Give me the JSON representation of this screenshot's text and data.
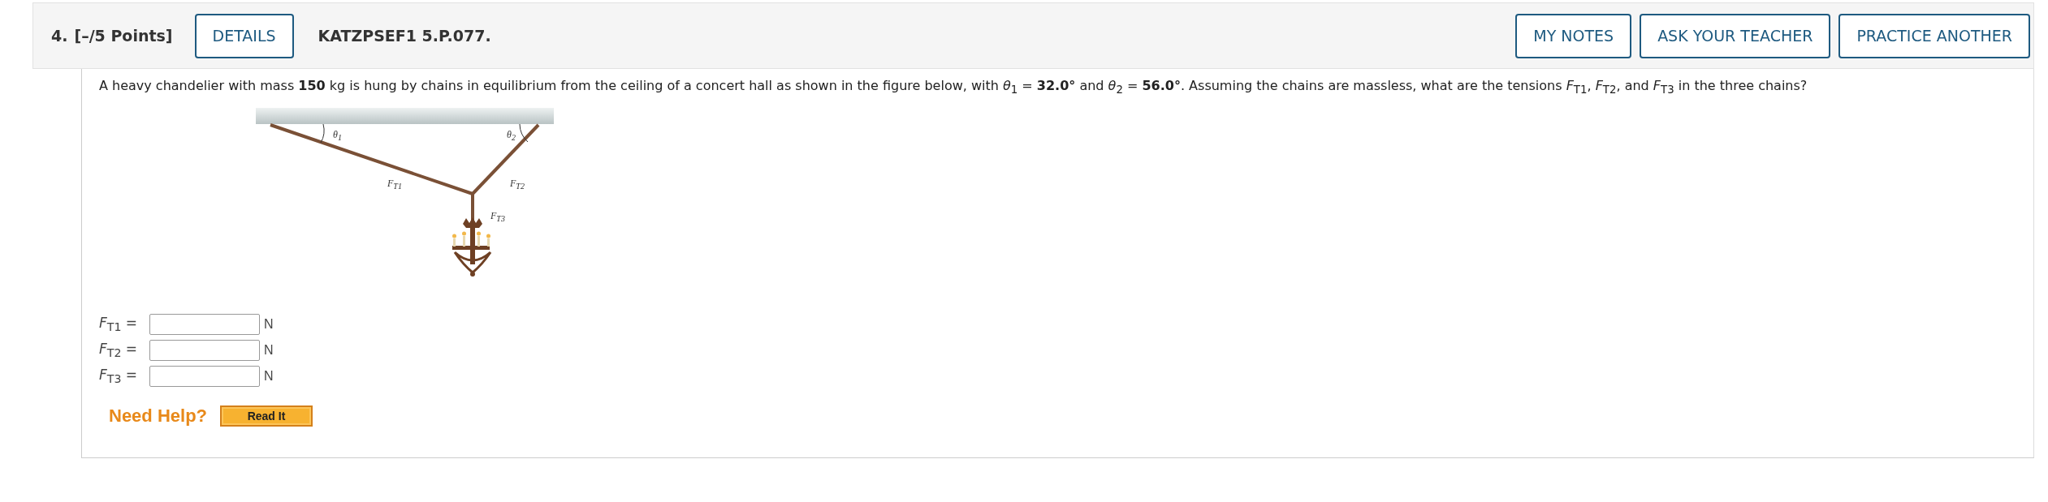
{
  "question": {
    "number": "4.",
    "points": "[–/5 Points]",
    "details_button": "DETAILS",
    "code": "KATZPSEF1 5.P.077.",
    "actions": [
      "MY NOTES",
      "ASK YOUR TEACHER",
      "PRACTICE ANOTHER"
    ]
  },
  "problem": {
    "text": "A heavy chandelier with mass **150** kg is hung by chains in equilibrium from the ceiling of a concert hall as shown in the figure below, with *θ*$_{1}$ = **32.0°** and *θ*$_{2}$ = **56.0°**. Assuming the chains are massless, what are the tensions *F*$_{T1}$, *F*$_{T2}$, and *F*$_{T3}$ in the three chains?",
    "figure_labels": [
      "θ$_{1}$",
      "θ$_{2}$",
      "F$_{T1}$",
      "F$_{T2}$",
      "F$_{T3}$"
    ]
  },
  "answers": [
    {
      "label": "*F*$_{T1}$ =",
      "unit": "N"
    },
    {
      "label": "*F*$_{T2}$ =",
      "unit": "N"
    },
    {
      "label": "*F*$_{T3}$ =",
      "unit": "N"
    }
  ],
  "help": {
    "label": "Need Help?",
    "button": "Read It"
  }
}
